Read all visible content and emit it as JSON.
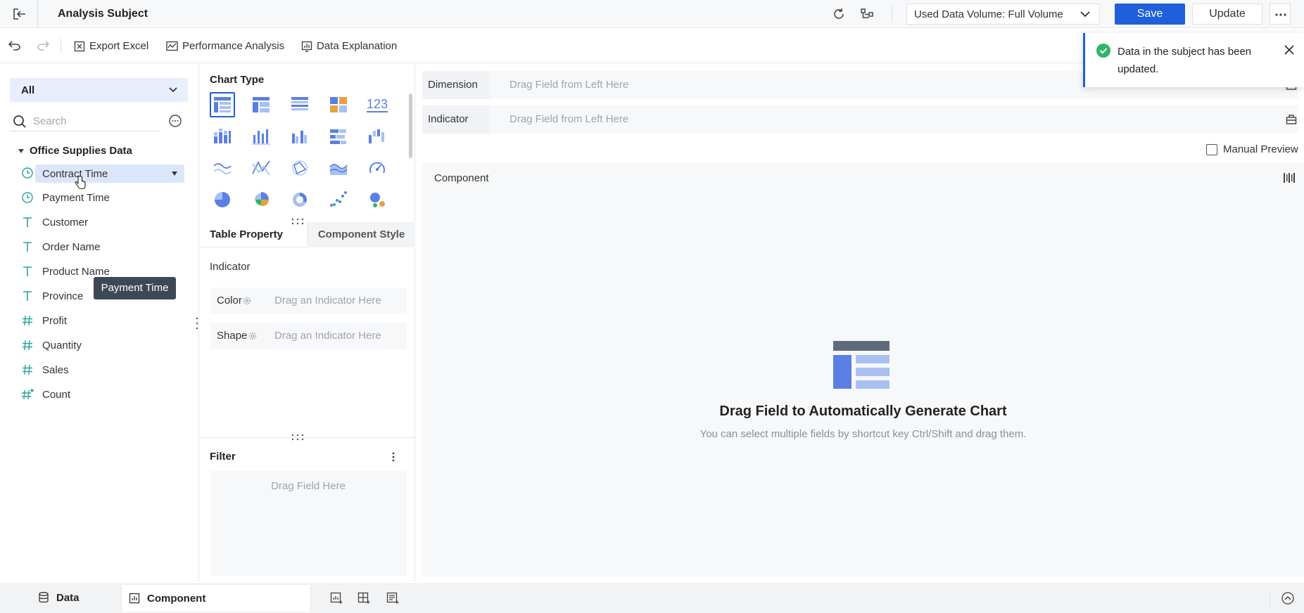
{
  "header": {
    "title": "Analysis Subject",
    "volume_label": "Used Data Volume: Full Volume",
    "save_label": "Save",
    "update_label": "Update"
  },
  "toolbar": {
    "export_excel": "Export Excel",
    "performance_analysis": "Performance Analysis",
    "data_explanation": "Data Explanation"
  },
  "left_panel": {
    "scope": "All",
    "search_placeholder": "Search",
    "group": "Office Supplies Data",
    "fields": [
      {
        "label": "Contract Time",
        "type": "time-icon"
      },
      {
        "label": "Payment Time",
        "type": "time-icon"
      },
      {
        "label": "Customer",
        "type": "text-icon"
      },
      {
        "label": "Order Name",
        "type": "text-icon"
      },
      {
        "label": "Product Name",
        "type": "text-icon"
      },
      {
        "label": "Province",
        "type": "text-icon"
      },
      {
        "label": "Profit",
        "type": "number-icon"
      },
      {
        "label": "Quantity",
        "type": "number-icon"
      },
      {
        "label": "Sales",
        "type": "number-icon"
      },
      {
        "label": "Count",
        "type": "number-icon"
      }
    ],
    "tooltip": "Payment Time"
  },
  "middle_panel": {
    "chart_type_title": "Chart Type",
    "chart_type_tile_label": "123",
    "tab_table_property": "Table Property",
    "tab_component_style": "Component Style",
    "indicator_label": "Indicator",
    "color_label": "Color",
    "color_placeholder": "Drag an Indicator Here",
    "shape_label": "Shape",
    "shape_placeholder": "Drag an Indicator Here",
    "filter_title": "Filter",
    "filter_placeholder": "Drag Field Here"
  },
  "right_panel": {
    "dimension_label": "Dimension",
    "dimension_placeholder": "Drag Field from Left Here",
    "indicator_label": "Indicator",
    "indicator_placeholder": "Drag Field from Left Here",
    "manual_preview": "Manual Preview",
    "component_title": "Component",
    "empty_title": "Drag Field to Automatically Generate Chart",
    "empty_subtitle": "You can select multiple fields by shortcut key Ctrl/Shift and drag them."
  },
  "notification": {
    "message": "Data in the subject has been updated."
  },
  "bottom_bar": {
    "data_tab": "Data",
    "component_tab": "Component"
  },
  "colors": {
    "accent": "#1f5fdb",
    "field_icon": "#2aa39b",
    "success": "#2fb56a",
    "chart_blue": "#5b7fe3",
    "chart_light": "#a9c0f3"
  }
}
